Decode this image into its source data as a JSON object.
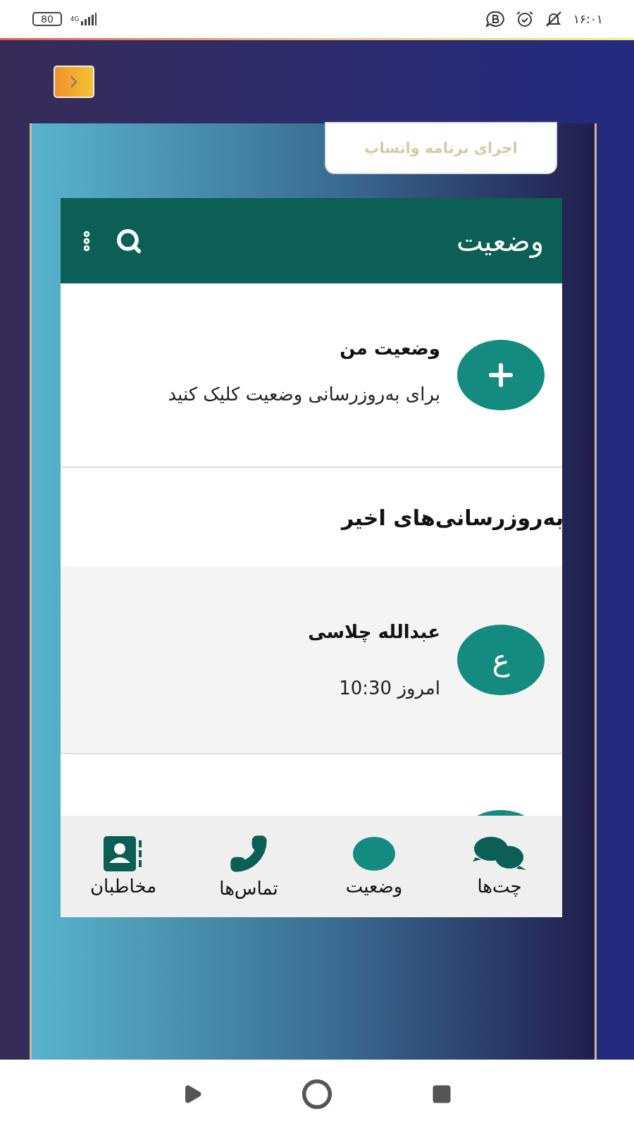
{
  "status_bar": {
    "battery": "80",
    "network": "4G",
    "time": "۱۶:۰۱"
  },
  "launch_button": "اجرای برنامه واتساپ",
  "header": {
    "title": "وضعیت"
  },
  "my_status": {
    "title": "وضعیت من",
    "subtitle": "برای به‌روزرسانی وضعیت کلیک کنید"
  },
  "recent_heading": "به‌روزرسانی‌های اخیر",
  "updates": [
    {
      "initial": "ع",
      "name": "عبدالله چلاسی",
      "time": "امروز 10:30",
      "kind": "full"
    },
    {
      "kind": "hidden"
    }
  ],
  "nav_tabs": [
    {
      "label": "چت‌ها",
      "kind": "chats"
    },
    {
      "label": "وضعیت",
      "kind": "status"
    },
    {
      "label": "تماس‌ها",
      "kind": "calls"
    },
    {
      "label": "مخاطبان",
      "kind": "contacts"
    }
  ]
}
